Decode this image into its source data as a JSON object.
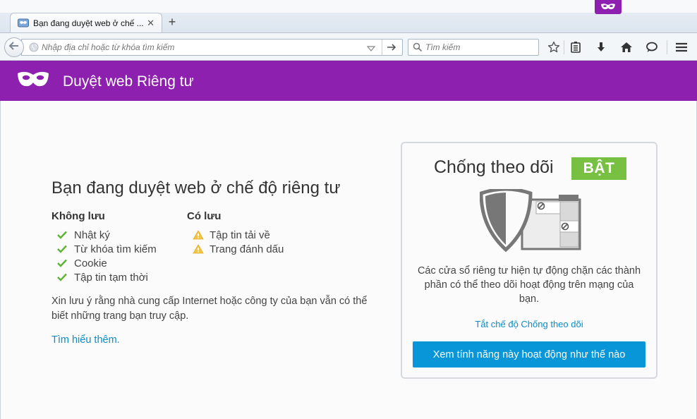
{
  "browser": {
    "tab": {
      "title": "Bạn đang duyệt web ở chế ...",
      "close_symbol": "✕"
    },
    "new_tab_symbol": "+",
    "urlbar": {
      "placeholder": "Nhập địa chỉ hoặc từ khóa tìm kiếm",
      "value": ""
    },
    "searchbar": {
      "placeholder": "Tìm kiếm",
      "value": ""
    },
    "toolbar_icons": [
      "star-icon",
      "reading-list-icon",
      "download-icon",
      "home-icon",
      "chat-icon",
      "hamburger-menu-icon"
    ]
  },
  "header": {
    "title": "Duyệt web Riêng tư"
  },
  "private_info": {
    "title": "Bạn đang duyệt web ở chế độ riêng tư",
    "not_saved": {
      "heading": "Không lưu",
      "items": [
        "Nhật ký",
        "Từ khóa tìm kiếm",
        "Cookie",
        "Tập tin tạm thời"
      ]
    },
    "saved": {
      "heading": "Có lưu",
      "items": [
        "Tập tin tải về",
        "Trang đánh dấu"
      ]
    },
    "note": "Xin lưu ý rằng nhà cung cấp Internet hoặc công ty của bạn vẫn có thể biết những trang bạn truy cập.",
    "learn_more": "Tìm hiểu thêm."
  },
  "tracking": {
    "title": "Chống theo dõi",
    "status": "BẬT",
    "description": "Các cửa sổ riêng tư hiện tự động chặn các thành phần có thể theo dõi hoạt động trên mạng của bạn.",
    "disable_link": "Tắt chế độ Chống theo dõi",
    "button": "Xem tính năng này hoạt động như thế nào"
  },
  "colors": {
    "private_purple": "#8d20ae",
    "status_green": "#77c042",
    "link_blue": "#0a8dc7",
    "button_blue": "#0996d9"
  }
}
